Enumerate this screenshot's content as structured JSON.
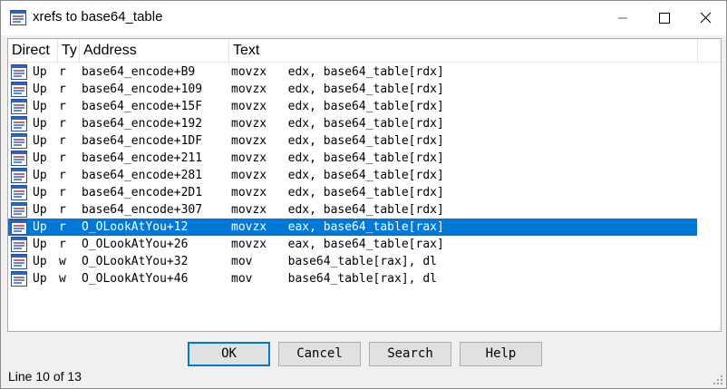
{
  "window": {
    "title": "xrefs to base64_table",
    "status": "Line 10 of 13"
  },
  "columns": {
    "direction": "Direct",
    "type": "Ty",
    "address": "Address",
    "text": "Text"
  },
  "rows": [
    {
      "dir": "Up",
      "type": "r",
      "address": "base64_encode+B9",
      "text": "movzx   edx, base64_table[rdx]"
    },
    {
      "dir": "Up",
      "type": "r",
      "address": "base64_encode+109",
      "text": "movzx   edx, base64_table[rdx]"
    },
    {
      "dir": "Up",
      "type": "r",
      "address": "base64_encode+15F",
      "text": "movzx   edx, base64_table[rdx]"
    },
    {
      "dir": "Up",
      "type": "r",
      "address": "base64_encode+192",
      "text": "movzx   edx, base64_table[rdx]"
    },
    {
      "dir": "Up",
      "type": "r",
      "address": "base64_encode+1DF",
      "text": "movzx   edx, base64_table[rdx]"
    },
    {
      "dir": "Up",
      "type": "r",
      "address": "base64_encode+211",
      "text": "movzx   edx, base64_table[rdx]"
    },
    {
      "dir": "Up",
      "type": "r",
      "address": "base64_encode+281",
      "text": "movzx   edx, base64_table[rdx]"
    },
    {
      "dir": "Up",
      "type": "r",
      "address": "base64_encode+2D1",
      "text": "movzx   edx, base64_table[rdx]"
    },
    {
      "dir": "Up",
      "type": "r",
      "address": "base64_encode+307",
      "text": "movzx   edx, base64_table[rdx]"
    },
    {
      "dir": "Up",
      "type": "r",
      "address": "O_OLookAtYou+12",
      "text": "movzx   eax, base64_table[rax]"
    },
    {
      "dir": "Up",
      "type": "r",
      "address": "O_OLookAtYou+26",
      "text": "movzx   eax, base64_table[rax]"
    },
    {
      "dir": "Up",
      "type": "w",
      "address": "O_OLookAtYou+32",
      "text": "mov     base64_table[rax], dl"
    },
    {
      "dir": "Up",
      "type": "w",
      "address": "O_OLookAtYou+46",
      "text": "mov     base64_table[rax], dl"
    }
  ],
  "selected_row": 9,
  "buttons": {
    "ok": "OK",
    "cancel": "Cancel",
    "search": "Search",
    "help": "Help"
  },
  "icons": {
    "app": "xref-list-icon",
    "row": "xref-entry-icon",
    "minimize": "minimize-icon",
    "maximize": "maximize-icon",
    "close": "close-icon"
  },
  "colors": {
    "selection": "#0078d7",
    "default_button_border": "#0078d7"
  }
}
